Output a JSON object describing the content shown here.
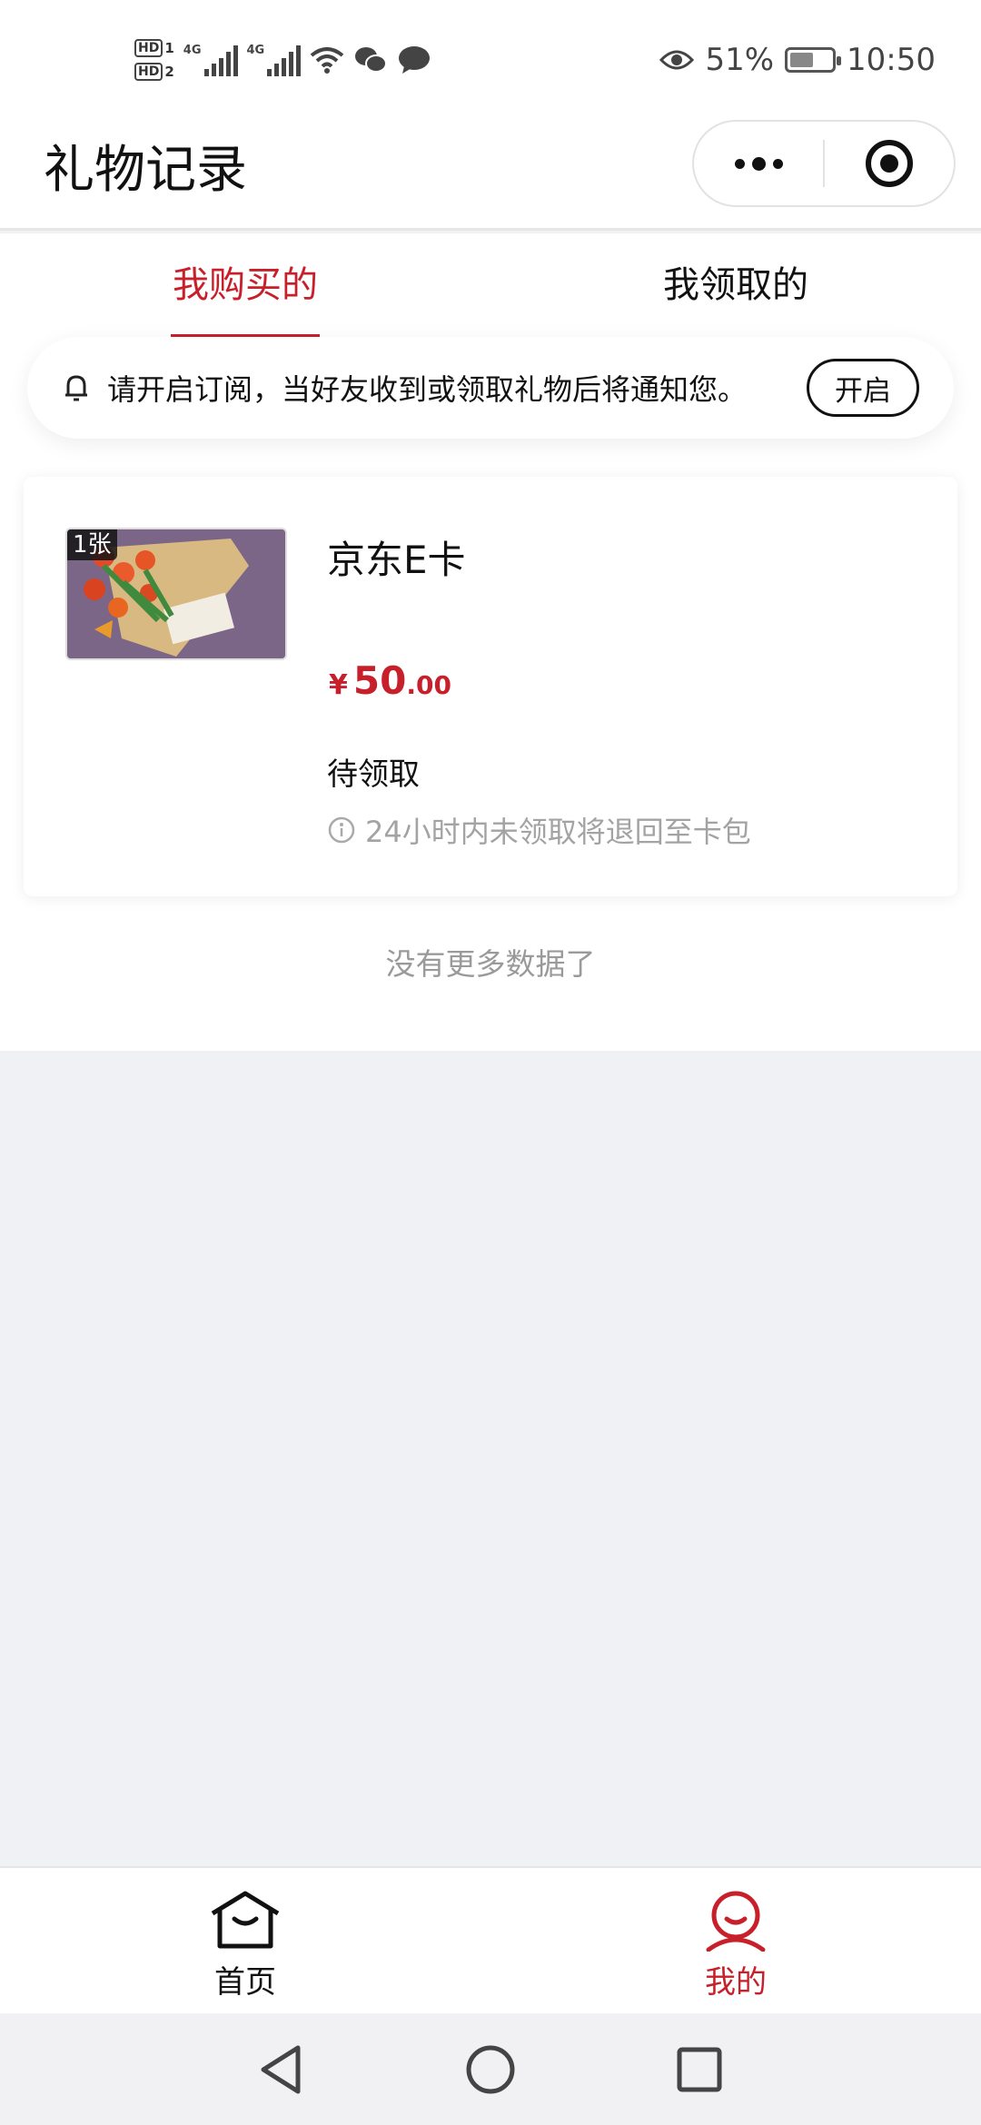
{
  "status_bar": {
    "hd1": "HD",
    "hd1_sim": "1",
    "hd2": "HD",
    "hd2_sim": "2",
    "signal1_tag": "4G",
    "signal2_tag": "4G",
    "battery_percent": "51%",
    "time": "10:50",
    "icons": [
      "signal-icon",
      "wifi-icon",
      "wechat-icon",
      "message-icon",
      "eye-icon",
      "battery-icon"
    ]
  },
  "nav": {
    "title": "礼物记录",
    "icons": [
      "more-dots-icon",
      "close-target-icon"
    ]
  },
  "tabs": [
    {
      "label": "我购买的",
      "active": true
    },
    {
      "label": "我领取的",
      "active": false
    }
  ],
  "notice": {
    "text": "请开启订阅，当好友收到或领取礼物后将通知您。",
    "button": "开启"
  },
  "gift": {
    "count_badge": "1张",
    "name": "京东E卡",
    "currency": "¥",
    "price_int": "50",
    "price_dec": ".00",
    "status": "待领取",
    "hint": "24小时内未领取将退回至卡包"
  },
  "no_more": "没有更多数据了",
  "tabbar": [
    {
      "label": "首页",
      "icon": "home-icon"
    },
    {
      "label": "我的",
      "icon": "user-icon",
      "active": true
    }
  ],
  "colors": {
    "accent": "#c8202b",
    "page_bg": "#f0f1f4",
    "muted": "#a3a3a3"
  }
}
